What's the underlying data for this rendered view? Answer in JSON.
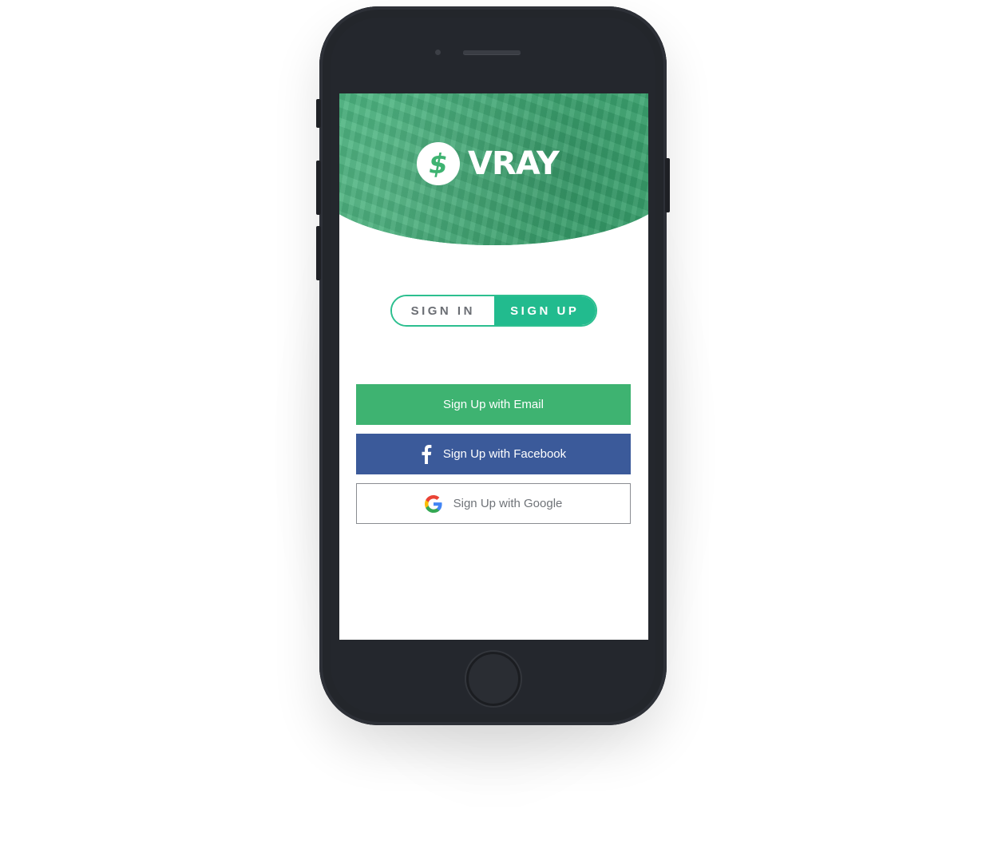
{
  "brand": {
    "name": "VRAY",
    "primary_color": "#3eb371",
    "accent_color": "#22bb8e"
  },
  "auth_toggle": {
    "sign_in_label": "SIGN IN",
    "sign_up_label": "SIGN UP",
    "selected": "SIGN UP"
  },
  "buttons": {
    "email_label": "Sign Up with Email",
    "facebook_label": "Sign Up with Facebook",
    "google_label": "Sign Up with Google"
  },
  "icons": {
    "logo": "dollar-sign-icon",
    "facebook": "facebook-icon",
    "google": "google-icon"
  }
}
